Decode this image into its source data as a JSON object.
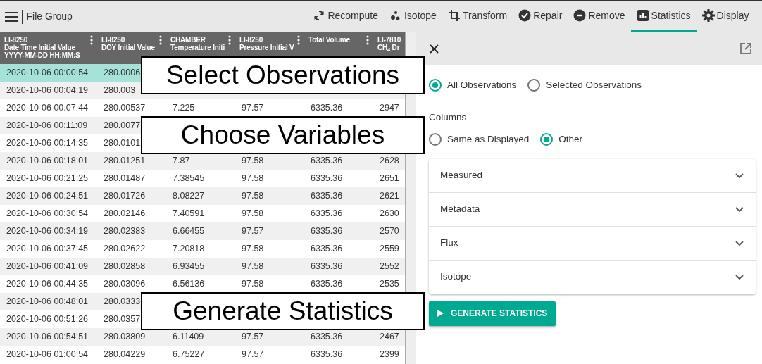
{
  "toolbar": {
    "title": "File Group",
    "tools": [
      {
        "label": "Recompute",
        "selected": false
      },
      {
        "label": "Isotope",
        "selected": false
      },
      {
        "label": "Transform",
        "selected": false
      },
      {
        "label": "Repair",
        "selected": false
      },
      {
        "label": "Remove",
        "selected": false
      },
      {
        "label": "Statistics",
        "selected": true
      },
      {
        "label": "Display",
        "selected": false
      }
    ]
  },
  "table": {
    "columns": [
      {
        "lines": [
          "LI-8250",
          "Date Time Initial Value",
          "YYYY-MM-DD HH:MM:S"
        ],
        "menu": true
      },
      {
        "lines": [
          "LI-8250",
          "DOY Initial Value"
        ],
        "menu": true
      },
      {
        "lines": [
          "CHAMBER",
          "Temperature Initi"
        ],
        "menu": true
      },
      {
        "lines": [
          "LI-8250",
          "Pressure Initial V"
        ],
        "menu": true
      },
      {
        "lines": [
          "Total Volume"
        ],
        "menu": true
      },
      {
        "lines": [
          "LI-7810",
          "CH$_{4}$ Dr"
        ],
        "menu": false
      }
    ],
    "rows": [
      {
        "selected": true,
        "cells": [
          "2020-10-06 00:00:54",
          "280.0006",
          null,
          null,
          null,
          null
        ]
      },
      {
        "selected": false,
        "cells": [
          "2020-10-06 00:04:19",
          "280.003",
          null,
          null,
          null,
          null
        ]
      },
      {
        "selected": false,
        "cells": [
          "2020-10-06 00:07:44",
          "280.00537",
          "7.225",
          "97.57",
          "6335.36",
          "2947"
        ]
      },
      {
        "selected": false,
        "cells": [
          "2020-10-06 00:11:09",
          "280.0077",
          null,
          null,
          null,
          null
        ]
      },
      {
        "selected": false,
        "cells": [
          "2020-10-06 00:14:35",
          "280.0101",
          null,
          null,
          null,
          null
        ]
      },
      {
        "selected": false,
        "cells": [
          "2020-10-06 00:18:01",
          "280.01251",
          "7.87",
          "97.58",
          "6335.36",
          "2628"
        ]
      },
      {
        "selected": false,
        "cells": [
          "2020-10-06 00:21:25",
          "280.01487",
          "7.38545",
          "97.58",
          "6335.36",
          "2651"
        ]
      },
      {
        "selected": false,
        "cells": [
          "2020-10-06 00:24:51",
          "280.01726",
          "8.08227",
          "97.58",
          "6335.36",
          "2621"
        ]
      },
      {
        "selected": false,
        "cells": [
          "2020-10-06 00:30:54",
          "280.02146",
          "7.40591",
          "97.58",
          "6335.36",
          "2630"
        ]
      },
      {
        "selected": false,
        "cells": [
          "2020-10-06 00:34:19",
          "280.02383",
          "6.66455",
          "97.57",
          "6335.36",
          "2570"
        ]
      },
      {
        "selected": false,
        "cells": [
          "2020-10-06 00:37:45",
          "280.02622",
          "7.20818",
          "97.58",
          "6335.36",
          "2559"
        ]
      },
      {
        "selected": false,
        "cells": [
          "2020-10-06 00:41:09",
          "280.02858",
          "6.93455",
          "97.58",
          "6335.36",
          "2552"
        ]
      },
      {
        "selected": false,
        "cells": [
          "2020-10-06 00:44:35",
          "280.03096",
          "6.56136",
          "97.58",
          "6335.36",
          "2535"
        ]
      },
      {
        "selected": false,
        "cells": [
          "2020-10-06 00:48:01",
          "280.0333",
          null,
          null,
          null,
          null
        ]
      },
      {
        "selected": false,
        "cells": [
          "2020-10-06 00:51:26",
          "280.0357",
          null,
          null,
          null,
          null
        ]
      },
      {
        "selected": false,
        "cells": [
          "2020-10-06 00:54:51",
          "280.03809",
          "6.11409",
          "97.57",
          "6335.36",
          "2467"
        ]
      },
      {
        "selected": false,
        "cells": [
          "2020-10-06 01:00:54",
          "280.04229",
          "6.75227",
          "97.57",
          "6335.36",
          "2399"
        ]
      }
    ]
  },
  "callouts": [
    "Select Observations",
    "Choose Variables",
    "Generate Statistics"
  ],
  "panel": {
    "observations": [
      {
        "label": "All Observations",
        "selected": true
      },
      {
        "label": "Selected Observations",
        "selected": false
      }
    ],
    "columns_label": "Columns",
    "columns": [
      {
        "label": "Same as Displayed",
        "selected": false
      },
      {
        "label": "Other",
        "selected": true
      }
    ],
    "sections": [
      {
        "label": "Measured",
        "expanded": false
      },
      {
        "label": "Metadata",
        "expanded": false
      },
      {
        "label": "Flux",
        "expanded": false
      },
      {
        "label": "Isotope",
        "expanded": false
      }
    ],
    "button": "GENERATE STATISTICS"
  }
}
